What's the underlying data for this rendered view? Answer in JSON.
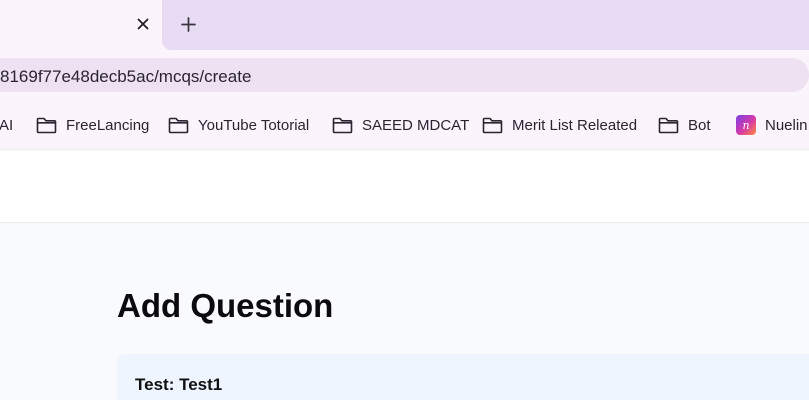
{
  "browser": {
    "tab": {
      "close_icon": "close-icon"
    },
    "new_tab_icon": "plus-icon",
    "address_bar": {
      "url": "8169f77e48decb5ac/mcqs/create"
    },
    "bookmarks": [
      {
        "label": "AI",
        "icon": "none"
      },
      {
        "label": "FreeLancing",
        "icon": "folder-icon"
      },
      {
        "label": "YouTube Totorial",
        "icon": "folder-icon"
      },
      {
        "label": "SAEED MDCAT",
        "icon": "folder-icon"
      },
      {
        "label": "Merit List Releated",
        "icon": "folder-icon"
      },
      {
        "label": "Bot",
        "icon": "folder-icon"
      },
      {
        "label": "Nuelin",
        "icon": "app-icon"
      }
    ],
    "colors": {
      "tabstrip": "#e8dcf4",
      "toolbar": "#fbf4fd",
      "omnibox": "#ede1f2"
    }
  },
  "page": {
    "title": "Add Question",
    "test_label": "Test: Test1",
    "colors": {
      "card": "#eef5ff",
      "background": "#f9fafb"
    }
  }
}
